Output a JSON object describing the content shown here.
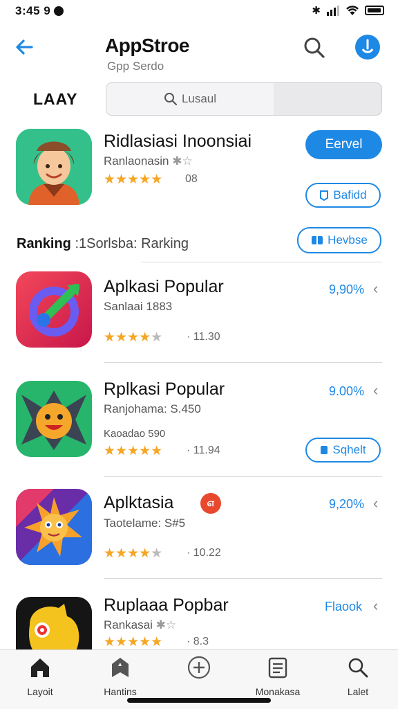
{
  "status": {
    "time": "3:45",
    "extra": "9",
    "icons": [
      "bluetooth-icon",
      "signal-icon",
      "wifi-icon",
      "battery-icon"
    ]
  },
  "nav": {
    "title": "AppStroe",
    "subtitle": "Gpp Serdo"
  },
  "section_label": "LAAY",
  "search": {
    "placeholder": "Lusaul"
  },
  "featured": {
    "title": "Ridlasiasi Inoonsiai",
    "subtitle": "Ranlaonasin",
    "rating_count": "08",
    "rating": 5,
    "primary_button": "Eervel",
    "secondary_button": "Bafidd"
  },
  "ranking": {
    "title": "Ranking",
    "rest": ":1Sorlsba:  Rarking",
    "button": "Hevbse"
  },
  "apps": [
    {
      "title": "Aplkasi Popular",
      "subtitle": "Sanlaai 1883",
      "rating": 4,
      "rating_count": "· 11.30",
      "percent": "9,90%"
    },
    {
      "title": "Rplkasi Popular",
      "subtitle": "Ranjohama: S.450",
      "extra": "Kaoadao 590",
      "rating": 5,
      "rating_count": "· 11.94",
      "percent": "9.00%",
      "button": "Sqhelt"
    },
    {
      "title": "Aplktasia",
      "subtitle": "Taotelame: S#5",
      "rating": 4,
      "rating_count": "· 10.22",
      "percent": "9,20%"
    },
    {
      "title": "Ruplaaa Popbar",
      "subtitle": "Rankasai",
      "rating": 5,
      "rating_count": "· 8.3",
      "percent": "Flaook"
    }
  ],
  "tabs": [
    {
      "label": "Layoit",
      "icon": "home-icon"
    },
    {
      "label": "Hantins",
      "icon": "bookmark-icon"
    },
    {
      "label": "",
      "icon": "add-icon"
    },
    {
      "label": "Monakasa",
      "icon": "list-icon"
    },
    {
      "label": "Lalet",
      "icon": "search-icon"
    }
  ],
  "colors": {
    "accent": "#1e88e5",
    "star": "#f5a623"
  }
}
